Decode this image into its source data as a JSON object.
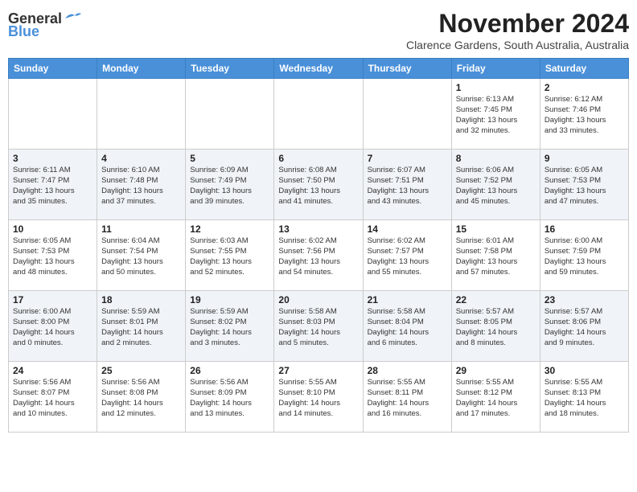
{
  "header": {
    "logo_line1": "General",
    "logo_line2": "Blue",
    "month": "November 2024",
    "location": "Clarence Gardens, South Australia, Australia"
  },
  "days_of_week": [
    "Sunday",
    "Monday",
    "Tuesday",
    "Wednesday",
    "Thursday",
    "Friday",
    "Saturday"
  ],
  "weeks": [
    [
      {
        "day": "",
        "info": ""
      },
      {
        "day": "",
        "info": ""
      },
      {
        "day": "",
        "info": ""
      },
      {
        "day": "",
        "info": ""
      },
      {
        "day": "",
        "info": ""
      },
      {
        "day": "1",
        "info": "Sunrise: 6:13 AM\nSunset: 7:45 PM\nDaylight: 13 hours\nand 32 minutes."
      },
      {
        "day": "2",
        "info": "Sunrise: 6:12 AM\nSunset: 7:46 PM\nDaylight: 13 hours\nand 33 minutes."
      }
    ],
    [
      {
        "day": "3",
        "info": "Sunrise: 6:11 AM\nSunset: 7:47 PM\nDaylight: 13 hours\nand 35 minutes."
      },
      {
        "day": "4",
        "info": "Sunrise: 6:10 AM\nSunset: 7:48 PM\nDaylight: 13 hours\nand 37 minutes."
      },
      {
        "day": "5",
        "info": "Sunrise: 6:09 AM\nSunset: 7:49 PM\nDaylight: 13 hours\nand 39 minutes."
      },
      {
        "day": "6",
        "info": "Sunrise: 6:08 AM\nSunset: 7:50 PM\nDaylight: 13 hours\nand 41 minutes."
      },
      {
        "day": "7",
        "info": "Sunrise: 6:07 AM\nSunset: 7:51 PM\nDaylight: 13 hours\nand 43 minutes."
      },
      {
        "day": "8",
        "info": "Sunrise: 6:06 AM\nSunset: 7:52 PM\nDaylight: 13 hours\nand 45 minutes."
      },
      {
        "day": "9",
        "info": "Sunrise: 6:05 AM\nSunset: 7:53 PM\nDaylight: 13 hours\nand 47 minutes."
      }
    ],
    [
      {
        "day": "10",
        "info": "Sunrise: 6:05 AM\nSunset: 7:53 PM\nDaylight: 13 hours\nand 48 minutes."
      },
      {
        "day": "11",
        "info": "Sunrise: 6:04 AM\nSunset: 7:54 PM\nDaylight: 13 hours\nand 50 minutes."
      },
      {
        "day": "12",
        "info": "Sunrise: 6:03 AM\nSunset: 7:55 PM\nDaylight: 13 hours\nand 52 minutes."
      },
      {
        "day": "13",
        "info": "Sunrise: 6:02 AM\nSunset: 7:56 PM\nDaylight: 13 hours\nand 54 minutes."
      },
      {
        "day": "14",
        "info": "Sunrise: 6:02 AM\nSunset: 7:57 PM\nDaylight: 13 hours\nand 55 minutes."
      },
      {
        "day": "15",
        "info": "Sunrise: 6:01 AM\nSunset: 7:58 PM\nDaylight: 13 hours\nand 57 minutes."
      },
      {
        "day": "16",
        "info": "Sunrise: 6:00 AM\nSunset: 7:59 PM\nDaylight: 13 hours\nand 59 minutes."
      }
    ],
    [
      {
        "day": "17",
        "info": "Sunrise: 6:00 AM\nSunset: 8:00 PM\nDaylight: 14 hours\nand 0 minutes."
      },
      {
        "day": "18",
        "info": "Sunrise: 5:59 AM\nSunset: 8:01 PM\nDaylight: 14 hours\nand 2 minutes."
      },
      {
        "day": "19",
        "info": "Sunrise: 5:59 AM\nSunset: 8:02 PM\nDaylight: 14 hours\nand 3 minutes."
      },
      {
        "day": "20",
        "info": "Sunrise: 5:58 AM\nSunset: 8:03 PM\nDaylight: 14 hours\nand 5 minutes."
      },
      {
        "day": "21",
        "info": "Sunrise: 5:58 AM\nSunset: 8:04 PM\nDaylight: 14 hours\nand 6 minutes."
      },
      {
        "day": "22",
        "info": "Sunrise: 5:57 AM\nSunset: 8:05 PM\nDaylight: 14 hours\nand 8 minutes."
      },
      {
        "day": "23",
        "info": "Sunrise: 5:57 AM\nSunset: 8:06 PM\nDaylight: 14 hours\nand 9 minutes."
      }
    ],
    [
      {
        "day": "24",
        "info": "Sunrise: 5:56 AM\nSunset: 8:07 PM\nDaylight: 14 hours\nand 10 minutes."
      },
      {
        "day": "25",
        "info": "Sunrise: 5:56 AM\nSunset: 8:08 PM\nDaylight: 14 hours\nand 12 minutes."
      },
      {
        "day": "26",
        "info": "Sunrise: 5:56 AM\nSunset: 8:09 PM\nDaylight: 14 hours\nand 13 minutes."
      },
      {
        "day": "27",
        "info": "Sunrise: 5:55 AM\nSunset: 8:10 PM\nDaylight: 14 hours\nand 14 minutes."
      },
      {
        "day": "28",
        "info": "Sunrise: 5:55 AM\nSunset: 8:11 PM\nDaylight: 14 hours\nand 16 minutes."
      },
      {
        "day": "29",
        "info": "Sunrise: 5:55 AM\nSunset: 8:12 PM\nDaylight: 14 hours\nand 17 minutes."
      },
      {
        "day": "30",
        "info": "Sunrise: 5:55 AM\nSunset: 8:13 PM\nDaylight: 14 hours\nand 18 minutes."
      }
    ]
  ]
}
